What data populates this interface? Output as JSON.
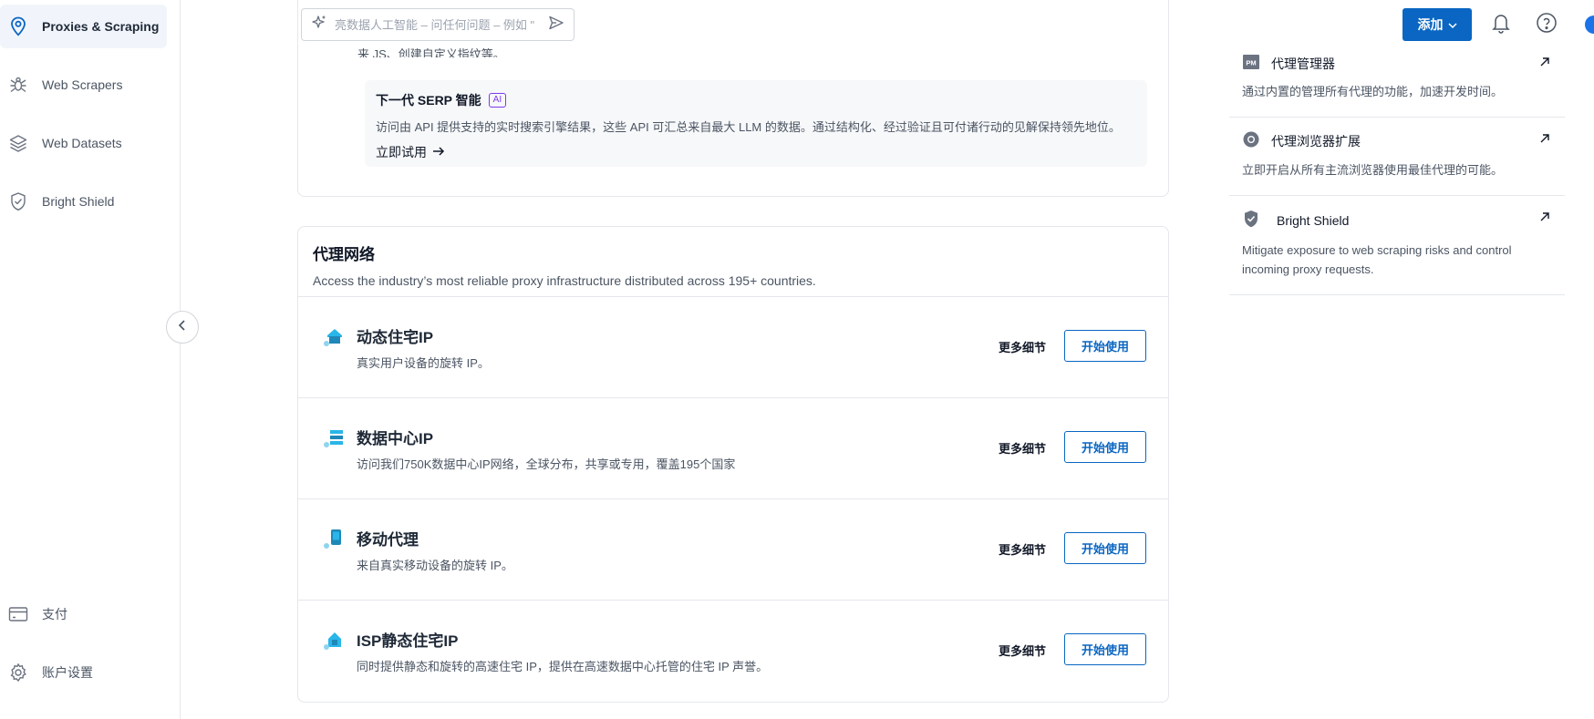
{
  "sidebar": {
    "items": [
      {
        "label": "Proxies & Scraping",
        "icon": "location-pin-icon",
        "active": true
      },
      {
        "label": "Web Scrapers",
        "icon": "spider-icon",
        "active": false
      },
      {
        "label": "Web Datasets",
        "icon": "layers-icon",
        "active": false
      },
      {
        "label": "Bright Shield",
        "icon": "shield-icon",
        "active": false
      }
    ],
    "bottom_items": [
      {
        "label": "支付",
        "icon": "credit-card-icon"
      },
      {
        "label": "账户设置",
        "icon": "gear-icon"
      }
    ]
  },
  "search": {
    "placeholder": "亮数据人工智能 – 问任何问题 – 例如 \""
  },
  "header": {
    "add_label": "添加"
  },
  "top_card": {
    "cut_text": "来 JS、创建自定义指纹等。",
    "serp_title": "下一代 SERP 智能",
    "ai_badge": "AI",
    "serp_desc": "访问由 API 提供支持的实时搜索引擎结果，这些 API 可汇总来自最大 LLM 的数据。通过结构化、经过验证且可付诸行动的见解保持领先地位。",
    "serp_link": "立即试用"
  },
  "network": {
    "title": "代理网络",
    "subtitle": "Access the industry’s most reliable proxy infrastructure distributed across 195+ countries.",
    "products": [
      {
        "name": "动态住宅IP",
        "desc": "真实用户设备的旋转 IP。",
        "icon": "residential-house-icon",
        "more": "更多细节",
        "start": "开始使用"
      },
      {
        "name": "数据中心IP",
        "desc": "访问我们750K数据中心IP网络，全球分布，共享或专用，覆盖195个国家",
        "icon": "datacenter-server-icon",
        "more": "更多细节",
        "start": "开始使用"
      },
      {
        "name": "移动代理",
        "desc": "来自真实移动设备的旋转 IP。",
        "icon": "mobile-phone-icon",
        "more": "更多细节",
        "start": "开始使用"
      },
      {
        "name": "ISP静态住宅IP",
        "desc": "同时提供静态和旋转的高速住宅 IP，提供在高速数据中心托管的住宅 IP 声誉。",
        "icon": "isp-house-icon",
        "more": "更多细节",
        "start": "开始使用"
      }
    ]
  },
  "right_panel": {
    "items": [
      {
        "title": "代理管理器",
        "icon_text": "PM",
        "desc": "通过内置的管理所有代理的功能，加速开发时间。"
      },
      {
        "title": "代理浏览器扩展",
        "desc": "立即开启从所有主流浏览器使用最佳代理的可能。"
      },
      {
        "title": "Bright Shield",
        "desc": "Mitigate exposure to web scraping risks and control incoming proxy requests."
      }
    ]
  },
  "colors": {
    "accent": "#0a66c2",
    "ai_badge": "#7c3aed",
    "product_icon": "#29b6e8"
  }
}
